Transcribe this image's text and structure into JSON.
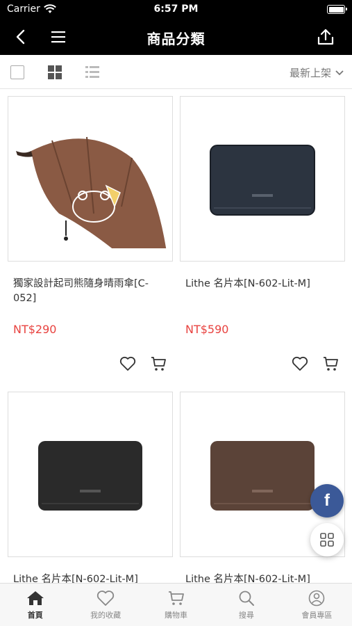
{
  "status": {
    "carrier": "Carrier",
    "time": "6:57 PM"
  },
  "header": {
    "title": "商品分類"
  },
  "toolbar": {
    "sort_label": "最新上架"
  },
  "products": [
    {
      "name": "獨家設計起司熊隨身晴雨傘[C-052]",
      "price": "NT$290"
    },
    {
      "name": "Lithe 名片本[N-602-Lit-M]",
      "price": "NT$590"
    },
    {
      "name": "Lithe 名片本[N-602-Lit-M]",
      "price": ""
    },
    {
      "name": "Lithe 名片本[N-602-Lit-M]",
      "price": ""
    }
  ],
  "fab": {
    "facebook_label": "f"
  },
  "tabs": [
    {
      "label": "首頁",
      "icon": "home-icon",
      "active": true
    },
    {
      "label": "我的收藏",
      "icon": "heart-icon",
      "active": false
    },
    {
      "label": "購物車",
      "icon": "cart-icon",
      "active": false
    },
    {
      "label": "搜尋",
      "icon": "search-icon",
      "active": false
    },
    {
      "label": "會員專區",
      "icon": "user-icon",
      "active": false
    }
  ],
  "colors": {
    "price": "#e8423f",
    "header_bg": "#000000",
    "facebook": "#3b5998"
  }
}
